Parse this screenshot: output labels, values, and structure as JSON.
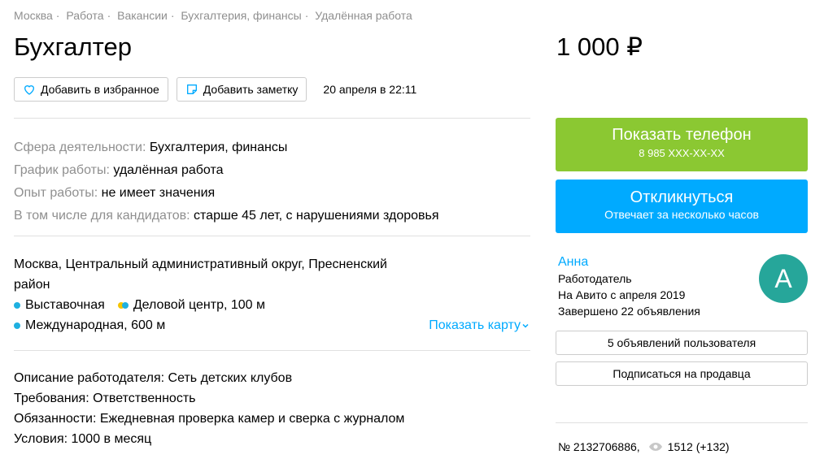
{
  "breadcrumbs": [
    "Москва",
    "Работа",
    "Вакансии",
    "Бухгалтерия, финансы",
    "Удалённая работа"
  ],
  "title": "Бухгалтер",
  "actions": {
    "favorite_label": "Добавить в избранное",
    "note_label": "Добавить заметку",
    "date": "20 апреля в 22:11"
  },
  "params": [
    {
      "key": "Сфера деятельности:",
      "value": "Бухгалтерия, финансы"
    },
    {
      "key": "График работы:",
      "value": "удалённая работа"
    },
    {
      "key": "Опыт работы:",
      "value": "не имеет значения"
    },
    {
      "key": "В том числе для кандидатов:",
      "value": "старше 45 лет, с нарушениями здоровья"
    }
  ],
  "address": {
    "text": "Москва, Центральный административный округ, Пресненский район",
    "metro": [
      {
        "name": "Выставочная",
        "colors": [
          "#1fb0e0"
        ]
      },
      {
        "name": "Деловой центр, 100 м",
        "colors": [
          "#f5c400",
          "#1fb0e0"
        ]
      }
    ],
    "metro2": [
      {
        "name": "Международная, 600 м",
        "colors": [
          "#1fb0e0"
        ]
      }
    ],
    "show_map_label": "Показать карту"
  },
  "description": [
    "Описание работодателя: Сеть детских клубов",
    "Требования: Ответственность",
    "Обязанности: Ежедневная проверка камер и сверка с журналом",
    "Условия: 1000 в месяц"
  ],
  "price": "1 000 ₽",
  "phone_button": {
    "label": "Показать телефон",
    "number": "8 985 XXX-XX-XX"
  },
  "respond_button": {
    "label": "Откликнуться",
    "sub": "Отвечает за несколько часов"
  },
  "seller": {
    "name": "Анна",
    "role": "Работодатель",
    "since": "На Авито с апреля 2019",
    "completed": "Завершено 22 объявления",
    "avatar_letter": "А"
  },
  "user_ads_label": "5 объявлений пользователя",
  "subscribe_label": "Подписаться на продавца",
  "item_meta": {
    "number": "№ 2132706886,",
    "views": "1512 (+132)"
  },
  "colors": {
    "accent_green": "#8bc832",
    "accent_blue": "#00aaff",
    "avatar": "#26a69a"
  }
}
